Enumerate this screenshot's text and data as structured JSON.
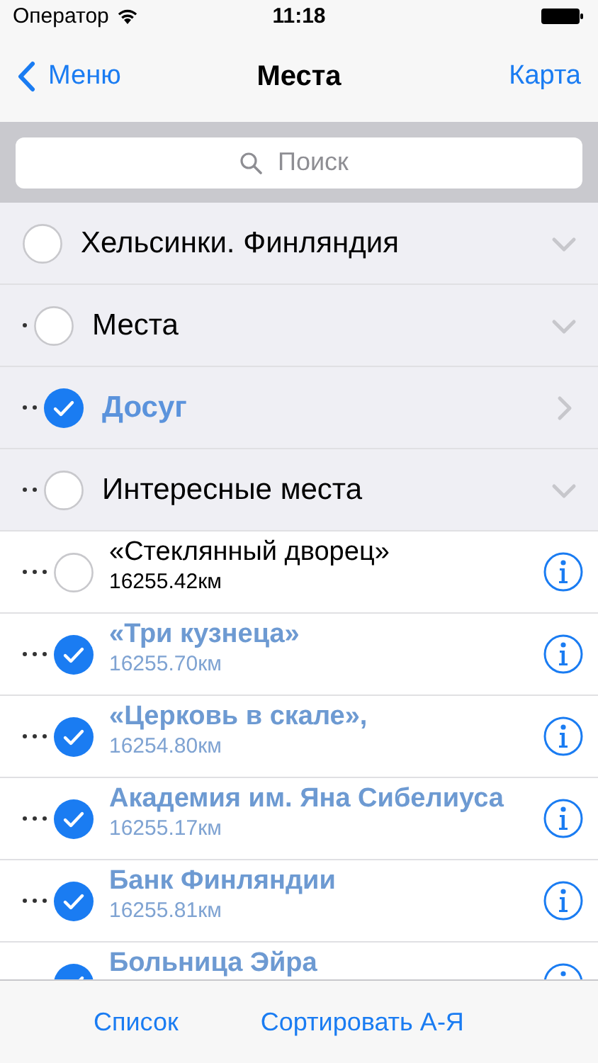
{
  "status_bar": {
    "carrier": "Оператор",
    "time": "11:18"
  },
  "nav": {
    "back": "Меню",
    "title": "Места",
    "action": "Карта"
  },
  "search": {
    "placeholder": "Поиск"
  },
  "tree": [
    {
      "kind": "category",
      "name": "Хельсинки. Финляндия",
      "checked": false,
      "expanded": true,
      "children": [
        {
          "kind": "category",
          "name": "Места",
          "checked": false,
          "expanded": true,
          "children": [
            {
              "kind": "category",
              "name": "Досуг",
              "checked": true,
              "expanded": false
            },
            {
              "kind": "category",
              "name": "Интересные места",
              "checked": false,
              "expanded": true,
              "children": [
                {
                  "kind": "place",
                  "name": "«Стеклянный дворец»",
                  "distance": "16255.42км",
                  "checked": false
                },
                {
                  "kind": "place",
                  "name": "«Три кузнеца»",
                  "distance": "16255.70км",
                  "checked": true
                },
                {
                  "kind": "place",
                  "name": "«Церковь в скале»,",
                  "distance": "16254.80км",
                  "checked": true
                },
                {
                  "kind": "place",
                  "name": "Академия им. Яна Сибелиуса",
                  "distance": "16255.17км",
                  "checked": true
                },
                {
                  "kind": "place",
                  "name": "Банк Финляндии",
                  "distance": "16255.81км",
                  "checked": true
                },
                {
                  "kind": "place",
                  "name": "Больница Эйра",
                  "checked": true
                }
              ]
            }
          ]
        }
      ]
    }
  ],
  "toolbar": [
    "Список",
    "Сортировать А-Я"
  ]
}
